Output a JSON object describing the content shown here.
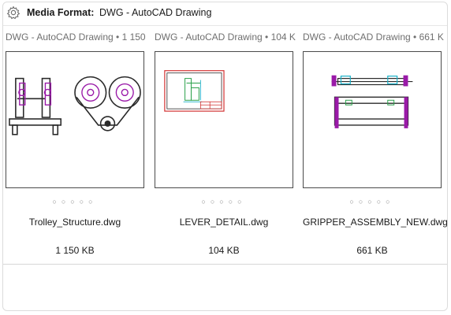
{
  "header": {
    "label": "Media Format:",
    "value": "DWG - AutoCAD Drawing",
    "icon": "gear-icon"
  },
  "files": [
    {
      "meta": "DWG - AutoCAD Drawing • 1 150",
      "name": "Trolley_Structure.dwg",
      "size": "1 150 KB",
      "dots": "○○○○○"
    },
    {
      "meta": "DWG - AutoCAD Drawing • 104 K",
      "name": "LEVER_DETAIL.dwg",
      "size": "104 KB",
      "dots": "○○○○○"
    },
    {
      "meta": "DWG - AutoCAD Drawing • 661 K",
      "name": "GRIPPER_ASSEMBLY_NEW.dwg",
      "size": "661 KB",
      "dots": "○○○○○"
    }
  ],
  "colors": {
    "drawing_primary": "#2a2a2a",
    "drawing_accent": "#9a1aa8",
    "drawing_green": "#2aa04a",
    "drawing_red": "#d23030",
    "drawing_cyan": "#1ab0c8"
  }
}
